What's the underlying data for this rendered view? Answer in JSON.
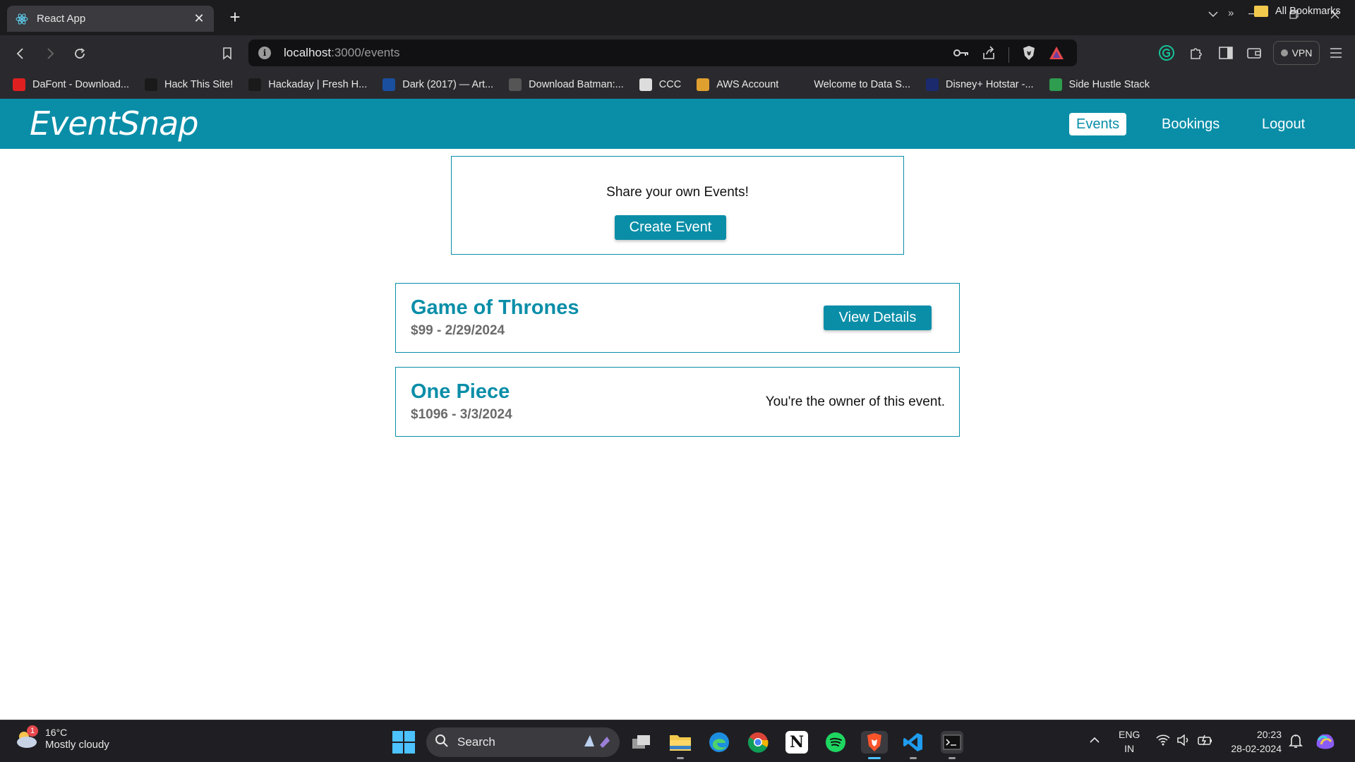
{
  "browser": {
    "tab_title": "React App",
    "url_host": "localhost",
    "url_path": ":3000/events",
    "vpn_label": "VPN",
    "bookmarks": [
      {
        "label": "DaFont - Download...",
        "icon": "dafont-icon",
        "color": "#e02020"
      },
      {
        "label": "Hack This Site!",
        "icon": "hts-icon",
        "color": "#1a1a1a"
      },
      {
        "label": "Hackaday | Fresh H...",
        "icon": "hackaday-icon",
        "color": "#1a1a1a"
      },
      {
        "label": "Dark (2017) — Art...",
        "icon": "dark-icon",
        "color": "#1a4fa0"
      },
      {
        "label": "Download Batman:...",
        "icon": "gear-icon",
        "color": "#555555"
      },
      {
        "label": "CCC",
        "icon": "ccc-icon",
        "color": "#dddddd"
      },
      {
        "label": "AWS Account",
        "icon": "aws-box-icon",
        "color": "#e0a030"
      },
      {
        "label": "Welcome to Data S...",
        "icon": "edx-icon",
        "color": "#2a2a2e"
      },
      {
        "label": "Disney+ Hotstar -...",
        "icon": "hotstar-icon",
        "color": "#1a2a6c"
      },
      {
        "label": "Side Hustle Stack",
        "icon": "sheet-icon",
        "color": "#2e9d4f"
      }
    ],
    "all_bookmarks_label": "All Bookmarks",
    "more_label": "»"
  },
  "app": {
    "logo": "EventSnap",
    "nav": [
      {
        "label": "Events",
        "active": true
      },
      {
        "label": "Bookings",
        "active": false
      },
      {
        "label": "Logout",
        "active": false
      }
    ],
    "share_prompt": "Share your own Events!",
    "create_button": "Create Event",
    "events": [
      {
        "title": "Game of Thrones",
        "meta": "$99 - 2/29/2024",
        "action": "View Details",
        "owner": false
      },
      {
        "title": "One Piece",
        "meta": "$1096 - 3/3/2024",
        "owner_text": "You're the owner of this event.",
        "owner": true
      }
    ],
    "accent_color": "#0a8ea8"
  },
  "taskbar": {
    "weather_temp": "16°C",
    "weather_condition": "Mostly cloudy",
    "weather_badge": "1",
    "search_label": "Search",
    "lang_line1": "ENG",
    "lang_line2": "IN",
    "time": "20:23",
    "date": "28-02-2024"
  }
}
